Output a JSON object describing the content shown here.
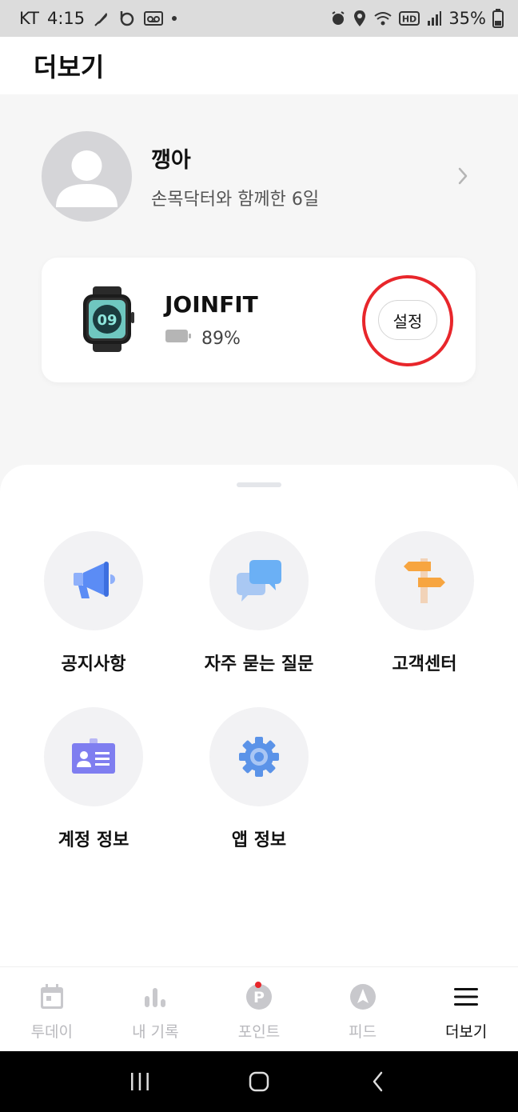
{
  "status_bar": {
    "carrier": "KT",
    "time": "4:15",
    "battery_percent": "35%",
    "left_icons": [
      "feather-icon",
      "b-app-icon",
      "voicemail-icon",
      "dot-icon"
    ],
    "right_icons": [
      "alarm-icon",
      "location-icon",
      "wifi-icon",
      "hd-icon",
      "signal-icon",
      "battery-icon"
    ]
  },
  "header": {
    "title": "더보기"
  },
  "profile": {
    "name": "깽아",
    "subtitle": "손목닥터와 함께한 6일"
  },
  "device": {
    "name": "JOINFIT",
    "battery": "89%",
    "watch_face_time": "09",
    "settings_label": "설정",
    "annotation_color": "#e8262b"
  },
  "menu": {
    "items": [
      {
        "label": "공지사항",
        "icon": "megaphone-icon"
      },
      {
        "label": "자주 묻는 질문",
        "icon": "chat-bubbles-icon"
      },
      {
        "label": "고객센터",
        "icon": "signpost-icon"
      },
      {
        "label": "계정 정보",
        "icon": "id-card-icon"
      },
      {
        "label": "앱 정보",
        "icon": "gear-icon"
      }
    ]
  },
  "bottom_nav": {
    "items": [
      {
        "label": "투데이",
        "icon": "calendar-icon",
        "active": false
      },
      {
        "label": "내 기록",
        "icon": "bar-chart-icon",
        "active": false
      },
      {
        "label": "포인트",
        "icon": "point-icon",
        "active": false,
        "badge": true
      },
      {
        "label": "피드",
        "icon": "compass-icon",
        "active": false
      },
      {
        "label": "더보기",
        "icon": "menu-icon",
        "active": true
      }
    ]
  },
  "colors": {
    "accent_red": "#e8262b",
    "megaphone_blue": "#5b8cf5",
    "signpost_orange": "#f7a540",
    "idcard_purple": "#7f7ef0",
    "gear_blue": "#5b93e8"
  }
}
